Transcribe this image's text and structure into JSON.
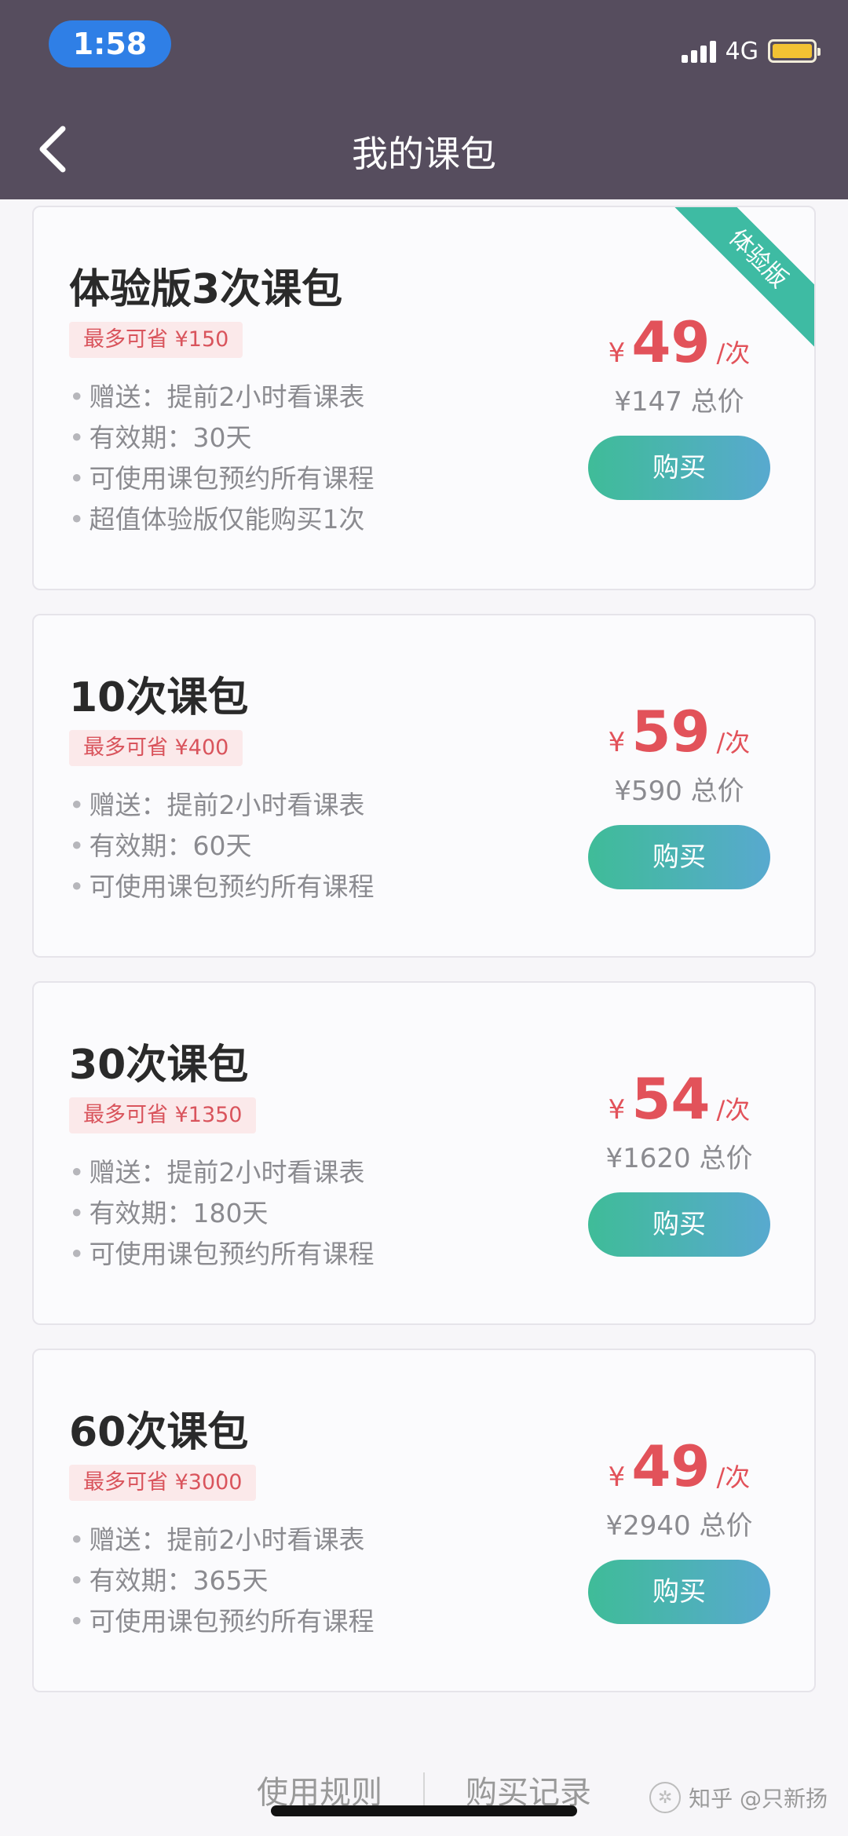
{
  "status_bar": {
    "time": "1:58",
    "network": "4G"
  },
  "nav": {
    "title": "我的课包"
  },
  "packages": [
    {
      "title": "体验版3次课包",
      "save": "最多可省 ¥150",
      "features": [
        "赠送：提前2小时看课表",
        "有效期：30天",
        "可使用课包预约所有课程",
        "超值体验版仅能购买1次"
      ],
      "currency": "¥",
      "price": "49",
      "unit": "/次",
      "total": "¥147 总价",
      "buy": "购买",
      "ribbon": "体验版"
    },
    {
      "title": "10次课包",
      "save": "最多可省 ¥400",
      "features": [
        "赠送：提前2小时看课表",
        "有效期：60天",
        "可使用课包预约所有课程"
      ],
      "currency": "¥",
      "price": "59",
      "unit": "/次",
      "total": "¥590 总价",
      "buy": "购买"
    },
    {
      "title": "30次课包",
      "save": "最多可省 ¥1350",
      "features": [
        "赠送：提前2小时看课表",
        "有效期：180天",
        "可使用课包预约所有课程"
      ],
      "currency": "¥",
      "price": "54",
      "unit": "/次",
      "total": "¥1620 总价",
      "buy": "购买"
    },
    {
      "title": "60次课包",
      "save": "最多可省 ¥3000",
      "features": [
        "赠送：提前2小时看课表",
        "有效期：365天",
        "可使用课包预约所有课程"
      ],
      "currency": "¥",
      "price": "49",
      "unit": "/次",
      "total": "¥2940 总价",
      "buy": "购买"
    }
  ],
  "footer": {
    "rules": "使用规则",
    "records": "购买记录",
    "watermark": "知乎 @只新扬"
  },
  "colors": {
    "topbar": "#564d5e",
    "price": "#e2525a",
    "button_start": "#3fbc98",
    "button_end": "#58a9cf",
    "ribbon": "#3ebba3"
  },
  "icons": {
    "back": "chevron-left-icon",
    "signal": "signal-icon",
    "battery": "battery-icon"
  }
}
